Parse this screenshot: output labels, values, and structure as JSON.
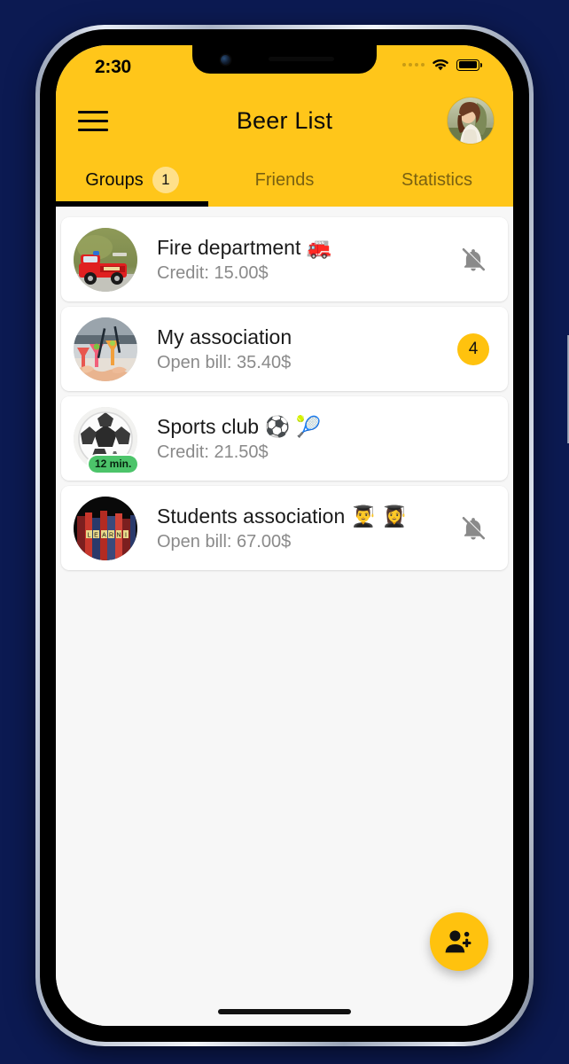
{
  "status_bar": {
    "time": "2:30",
    "signal_icon": "signal-dots-icon",
    "wifi_icon": "wifi-icon",
    "battery_icon": "battery-full-icon"
  },
  "app_bar": {
    "menu_icon": "hamburger-menu-icon",
    "title": "Beer List",
    "avatar_icon": "profile-avatar"
  },
  "tabs": [
    {
      "label": "Groups",
      "badge": "1",
      "active": true
    },
    {
      "label": "Friends",
      "badge": null,
      "active": false
    },
    {
      "label": "Statistics",
      "badge": null,
      "active": false
    }
  ],
  "groups": [
    {
      "name": "Fire department 🚒",
      "subtitle": "Credit: 15.00$",
      "trailing_type": "bell-off",
      "trailing_value": null,
      "time_badge": null,
      "avatar": "fire-truck-photo"
    },
    {
      "name": "My association",
      "subtitle": "Open bill: 35.40$",
      "trailing_type": "count",
      "trailing_value": "4",
      "time_badge": null,
      "avatar": "cocktail-toast-photo"
    },
    {
      "name": "Sports club ⚽ 🎾",
      "subtitle": "Credit: 21.50$",
      "trailing_type": "none",
      "trailing_value": null,
      "time_badge": "12 min.",
      "avatar": "soccer-ball-photo"
    },
    {
      "name": "Students association 👨‍🎓 👩‍🎓",
      "subtitle": "Open bill: 67.00$",
      "trailing_type": "bell-off",
      "trailing_value": null,
      "time_badge": null,
      "avatar": "books-learning-photo"
    }
  ],
  "fab": {
    "icon": "person-add-icon"
  },
  "colors": {
    "brand_yellow": "#FFC61A",
    "accent_yellow": "#FFC20E",
    "badge_light_yellow": "#FFE08A",
    "green_badge": "#4CC46A",
    "page_background": "#0C1A52",
    "content_background": "#F7F7F7",
    "card_background": "#FFFFFF",
    "text_primary": "#1B1B1B",
    "text_secondary": "#8A8A8A",
    "tab_inactive": "#7A6111"
  }
}
